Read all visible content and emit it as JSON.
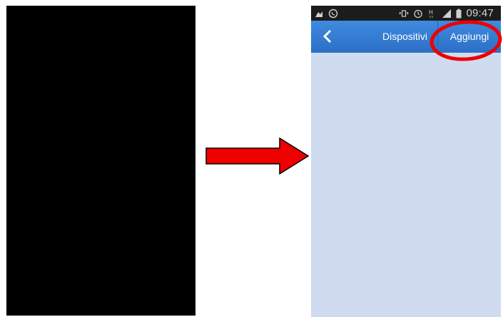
{
  "status_bar": {
    "time": "09:47",
    "left_icons": [
      "download-icon",
      "whatsapp-icon"
    ],
    "right_icons": [
      "vibrate-icon",
      "alarm-icon",
      "hspa-icon",
      "signal-icon",
      "battery-icon"
    ],
    "network_label": "H"
  },
  "nav": {
    "title": "Dispositivi",
    "action_label": "Aggiungi",
    "back_icon": "chevron-left-icon"
  },
  "colors": {
    "nav_bar": "#3a80d8",
    "content_bg": "#cfdcef",
    "annotation_red": "#ee0000",
    "left_panel": "#000000"
  }
}
